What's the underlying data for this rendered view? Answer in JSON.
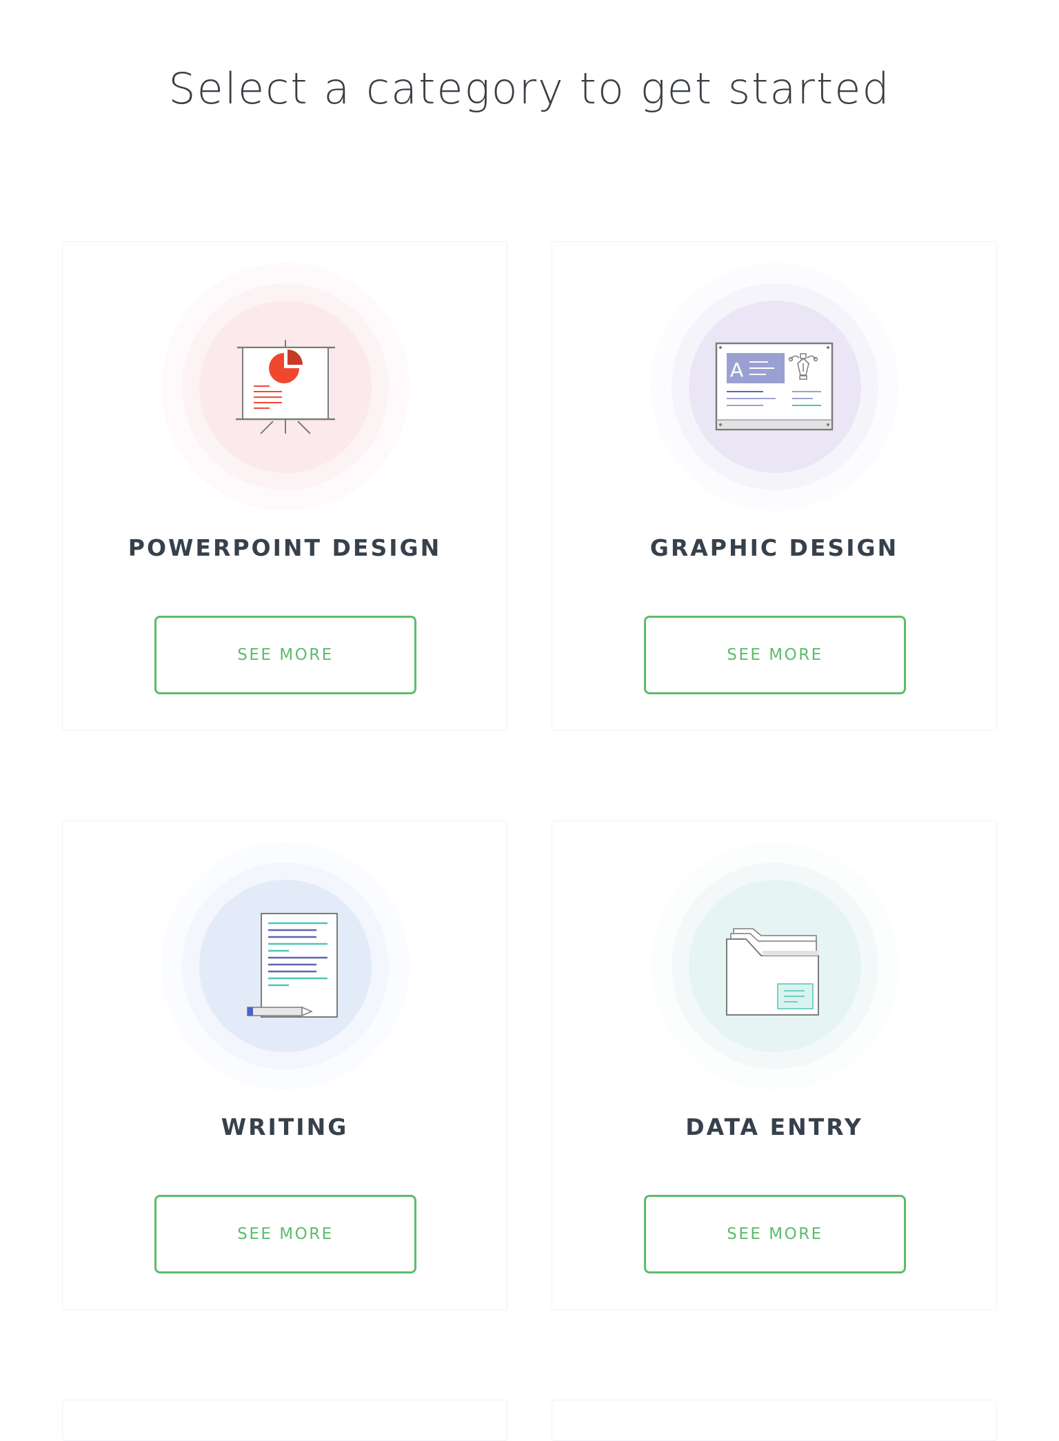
{
  "header": {
    "title": "Select a category to get started"
  },
  "categories": [
    {
      "title": "POWERPOINT DESIGN",
      "button_label": "SEE MORE",
      "icon": "presentation-board-icon",
      "halo_color": "#fbe9ec"
    },
    {
      "title": "GRAPHIC DESIGN",
      "button_label": "SEE MORE",
      "icon": "design-canvas-icon",
      "halo_color": "#ebe6f6"
    },
    {
      "title": "WRITING",
      "button_label": "SEE MORE",
      "icon": "document-pencil-icon",
      "halo_color": "#e3eaf8"
    },
    {
      "title": "DATA ENTRY",
      "button_label": "SEE MORE",
      "icon": "folder-icon",
      "halo_color": "#e7f4f4"
    }
  ],
  "colors": {
    "accent": "#5cbc6a",
    "heading": "#37414c"
  }
}
